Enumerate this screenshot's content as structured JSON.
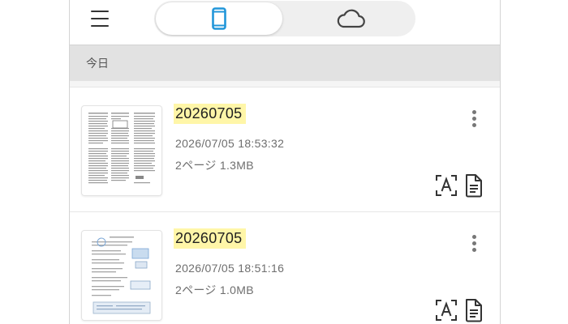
{
  "toolbar": {
    "menu_icon": "hamburger-menu-icon",
    "segments": [
      {
        "icon": "smartphone-icon",
        "active": true,
        "color": "#2196d9"
      },
      {
        "icon": "cloud-icon",
        "active": false,
        "color": "#444444"
      }
    ]
  },
  "section": {
    "header": "今日"
  },
  "documents": [
    {
      "title": "20260705",
      "datetime": "2026/07/05 18:53:32",
      "info": "2ページ 1.3MB",
      "highlight_color": "#fff6a8"
    },
    {
      "title": "20260705",
      "datetime": "2026/07/05 18:51:16",
      "info": "2ページ 1.0MB",
      "highlight_color": "#fff6a8"
    }
  ],
  "item_actions": {
    "more_icon": "more-vertical-icon",
    "ocr_icon": "text-recognition-icon",
    "document_icon": "document-text-icon"
  }
}
